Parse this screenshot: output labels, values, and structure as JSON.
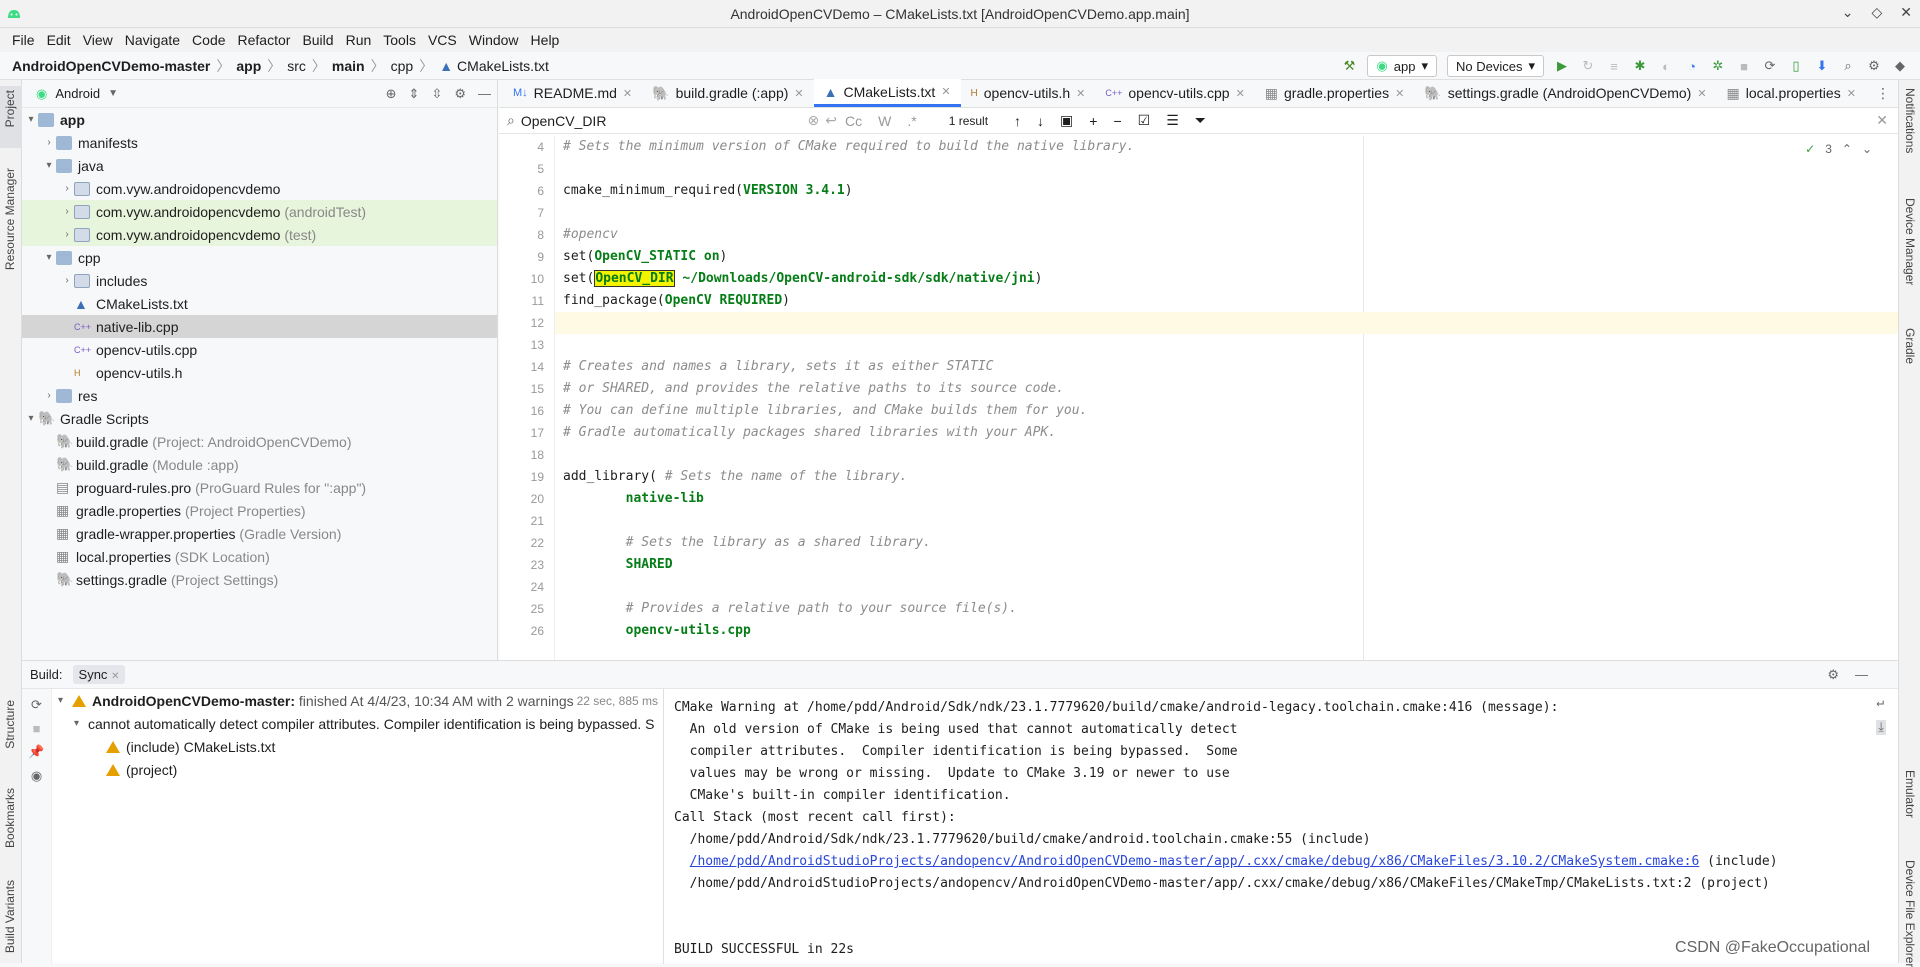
{
  "window": {
    "title": "AndroidOpenCVDemo – CMakeLists.txt [AndroidOpenCVDemo.app.main]"
  },
  "menu": [
    "File",
    "Edit",
    "View",
    "Navigate",
    "Code",
    "Refactor",
    "Build",
    "Run",
    "Tools",
    "VCS",
    "Window",
    "Help"
  ],
  "breadcrumb": [
    "AndroidOpenCVDemo-master",
    "app",
    "src",
    "main",
    "cpp",
    "CMakeLists.txt"
  ],
  "run_config": {
    "module": "app",
    "device": "No Devices"
  },
  "left_strip": [
    "Project",
    "Resource Manager",
    "Structure",
    "Bookmarks",
    "Build Variants"
  ],
  "right_strip": [
    "Notifications",
    "Device Manager",
    "Gradle",
    "Emulator",
    "Device File Explorer"
  ],
  "project_panel": {
    "view_selector": "Android",
    "tree": [
      {
        "label": "app",
        "extra": "",
        "bold": true
      },
      {
        "label": "manifests",
        "extra": ""
      },
      {
        "label": "java",
        "extra": ""
      },
      {
        "label": "com.vyw.androidopencvdemo",
        "extra": ""
      },
      {
        "label": "com.vyw.androidopencvdemo",
        "extra": "(androidTest)"
      },
      {
        "label": "com.vyw.androidopencvdemo",
        "extra": "(test)"
      },
      {
        "label": "cpp",
        "extra": ""
      },
      {
        "label": "includes",
        "extra": ""
      },
      {
        "label": "CMakeLists.txt",
        "extra": ""
      },
      {
        "label": "native-lib.cpp",
        "extra": ""
      },
      {
        "label": "opencv-utils.cpp",
        "extra": ""
      },
      {
        "label": "opencv-utils.h",
        "extra": ""
      },
      {
        "label": "res",
        "extra": ""
      },
      {
        "label": "Gradle Scripts",
        "extra": ""
      },
      {
        "label": "build.gradle",
        "extra": "(Project: AndroidOpenCVDemo)"
      },
      {
        "label": "build.gradle",
        "extra": "(Module :app)"
      },
      {
        "label": "proguard-rules.pro",
        "extra": "(ProGuard Rules for \":app\")"
      },
      {
        "label": "gradle.properties",
        "extra": "(Project Properties)"
      },
      {
        "label": "gradle-wrapper.properties",
        "extra": "(Gradle Version)"
      },
      {
        "label": "local.properties",
        "extra": "(SDK Location)"
      },
      {
        "label": "settings.gradle",
        "extra": "(Project Settings)"
      }
    ]
  },
  "tabs": [
    "README.md",
    "build.gradle (:app)",
    "CMakeLists.txt",
    "opencv-utils.h",
    "opencv-utils.cpp",
    "gradle.properties",
    "settings.gradle (AndroidOpenCVDemo)",
    "local.properties"
  ],
  "find": {
    "query": "OpenCV_DIR",
    "result": "1 result",
    "options": [
      "Cc",
      "W",
      ".*"
    ]
  },
  "editor": {
    "problems": "3",
    "lines": [
      {
        "n": "4",
        "text": "# Sets the minimum version of CMake required to build the native library."
      },
      {
        "n": "5",
        "text": ""
      },
      {
        "n": "6",
        "text": "cmake_minimum_required(VERSION 3.4.1)"
      },
      {
        "n": "7",
        "text": ""
      },
      {
        "n": "8",
        "text": "#opencv"
      },
      {
        "n": "9",
        "text": "set(OpenCV_STATIC on)"
      },
      {
        "n": "10",
        "text": "set(OpenCV_DIR ~/Downloads/OpenCV-android-sdk/sdk/native/jni)"
      },
      {
        "n": "11",
        "text": "find_package(OpenCV REQUIRED)"
      },
      {
        "n": "12",
        "text": ""
      },
      {
        "n": "13",
        "text": ""
      },
      {
        "n": "14",
        "text": "# Creates and names a library, sets it as either STATIC"
      },
      {
        "n": "15",
        "text": "# or SHARED, and provides the relative paths to its source code."
      },
      {
        "n": "16",
        "text": "# You can define multiple libraries, and CMake builds them for you."
      },
      {
        "n": "17",
        "text": "# Gradle automatically packages shared libraries with your APK."
      },
      {
        "n": "18",
        "text": ""
      },
      {
        "n": "19",
        "text": "add_library( # Sets the name of the library."
      },
      {
        "n": "20",
        "text": "        native-lib"
      },
      {
        "n": "21",
        "text": ""
      },
      {
        "n": "22",
        "text": "        # Sets the library as a shared library."
      },
      {
        "n": "23",
        "text": "        SHARED"
      },
      {
        "n": "24",
        "text": ""
      },
      {
        "n": "25",
        "text": "        # Provides a relative path to your source file(s)."
      },
      {
        "n": "26",
        "text": "        opencv-utils.cpp"
      }
    ]
  },
  "build_panel": {
    "tabs": [
      "Build:",
      "Sync"
    ],
    "tree": [
      {
        "label": "AndroidOpenCVDemo-master:",
        "extra": "finished At 4/4/23, 10:34 AM with 2 warnings",
        "time": "22 sec, 885 ms"
      },
      {
        "label": "cannot automatically detect compiler attributes.  Compiler identification is being bypassed.  S",
        "extra": "",
        "time": ""
      },
      {
        "label": "(include) CMakeLists.txt",
        "extra": "",
        "time": ""
      },
      {
        "label": "(project)",
        "extra": "",
        "time": ""
      }
    ],
    "output": [
      "CMake Warning at /home/pdd/Android/Sdk/ndk/23.1.7779620/build/cmake/android-legacy.toolchain.cmake:416 (message):",
      "  An old version of CMake is being used that cannot automatically detect",
      "  compiler attributes.  Compiler identification is being bypassed.  Some",
      "  values may be wrong or missing.  Update to CMake 3.19 or newer to use",
      "  CMake's built-in compiler identification.",
      "Call Stack (most recent call first):",
      "  /home/pdd/Android/Sdk/ndk/23.1.7779620/build/cmake/android.toolchain.cmake:55 (include)",
      "",
      "  /home/pdd/AndroidStudioProjects/andopencv/AndroidOpenCVDemo-master/app/.cxx/cmake/debug/x86/CMakeFiles/CMakeTmp/CMakeLists.txt:2 (project)",
      "",
      "",
      "BUILD SUCCESSFUL in 22s"
    ],
    "link_line": {
      "link": "/home/pdd/AndroidStudioProjects/andopencv/AndroidOpenCVDemo-master/app/.cxx/cmake/debug/x86/CMakeFiles/3.10.2/CMakeSystem.cmake:6",
      "suffix": " (include)"
    }
  },
  "watermark": "CSDN @FakeOccupational"
}
